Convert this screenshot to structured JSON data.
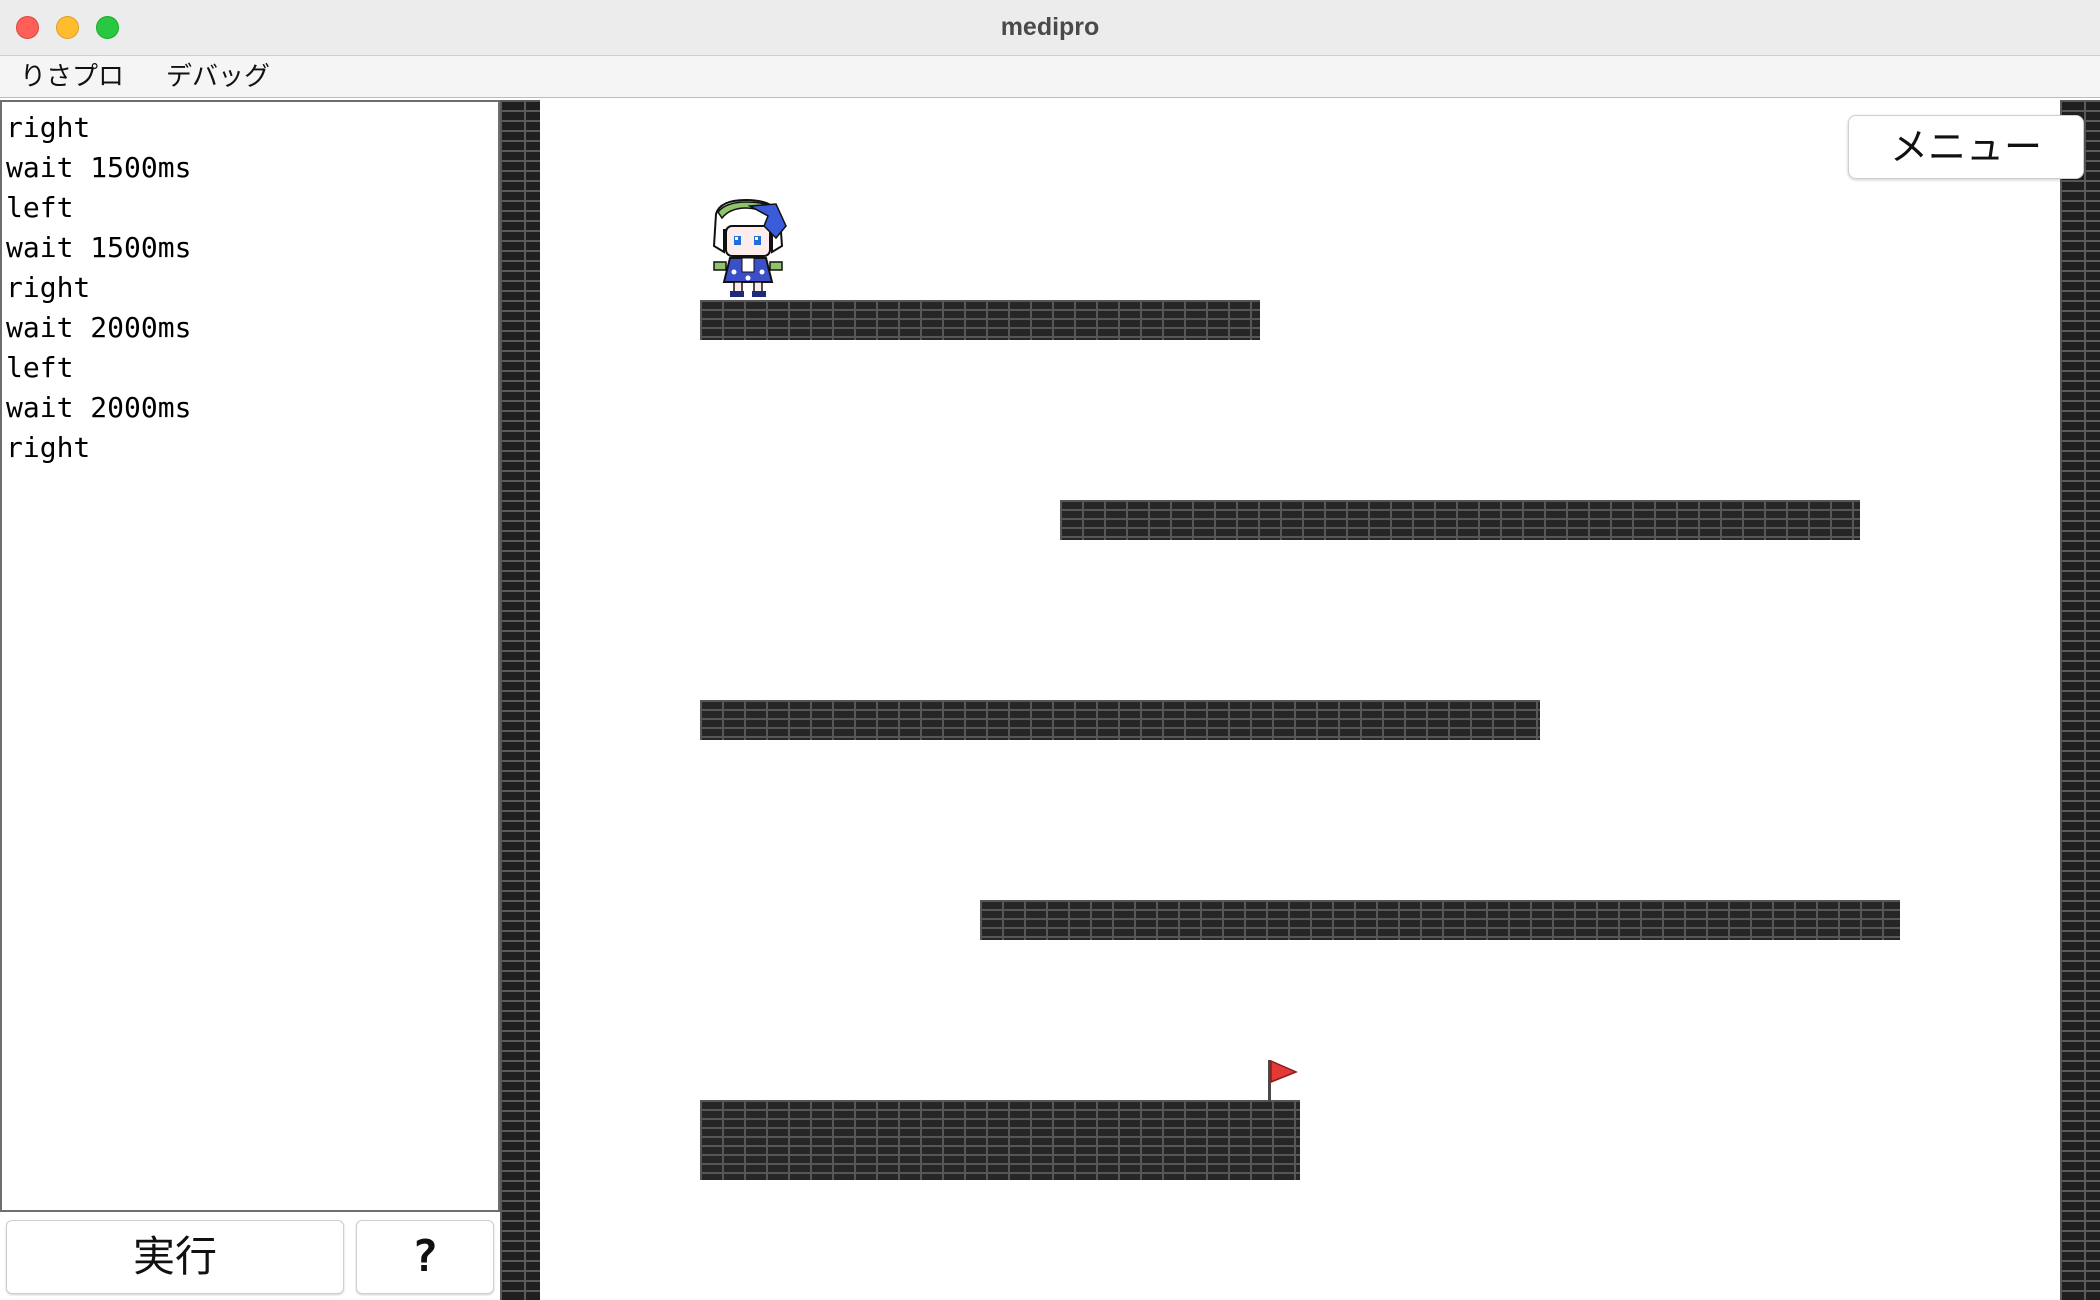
{
  "window": {
    "title": "medipro"
  },
  "menubar": {
    "items": [
      "りさプロ",
      "デバッグ"
    ]
  },
  "editor": {
    "lines": [
      "right",
      "wait 1500ms",
      "left",
      "wait 1500ms",
      "right",
      "wait 2000ms",
      "left",
      "wait 2000ms",
      "right"
    ]
  },
  "controls": {
    "run_label": "実行",
    "help_label": "?"
  },
  "game": {
    "menu_label": "メニュー",
    "platform_count": 5
  },
  "colors": {
    "brick_dark": "#262626",
    "brick_mortar": "#575757",
    "flag_red": "#e53935",
    "hair_blue": "#3a5cd8"
  },
  "icons": [
    "character-sprite",
    "goal-flag-icon"
  ]
}
